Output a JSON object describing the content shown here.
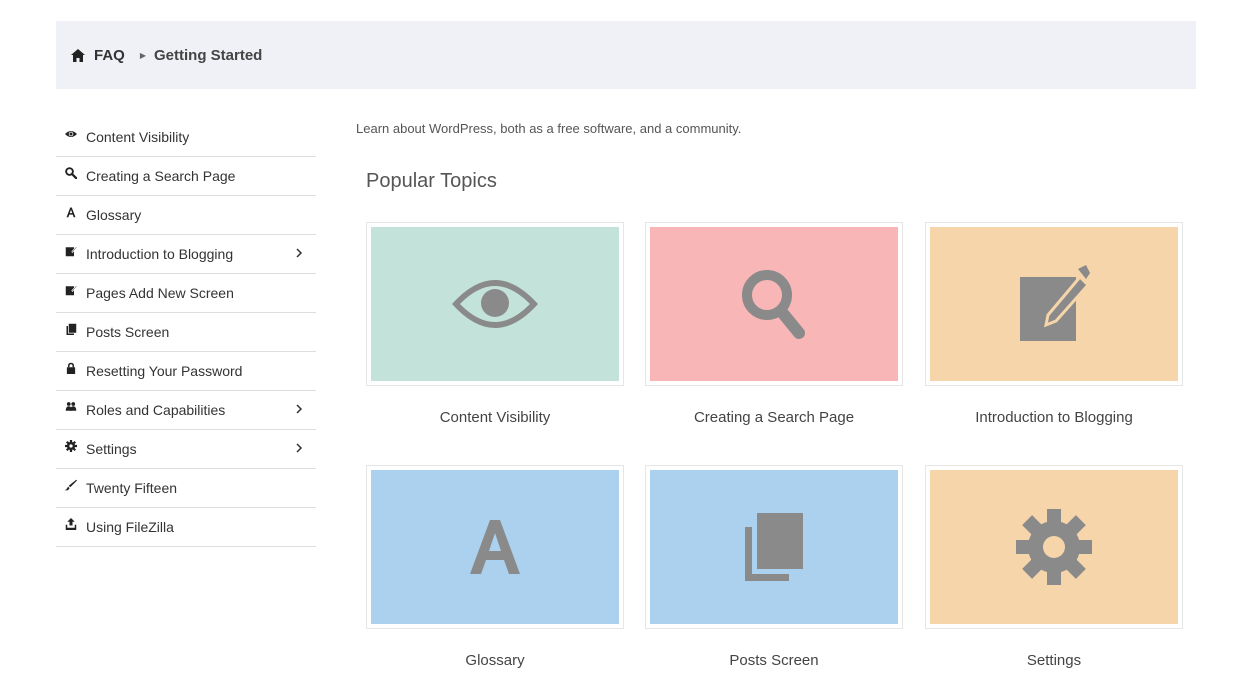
{
  "breadcrumb": {
    "home": "FAQ",
    "current": "Getting Started"
  },
  "sidebar": {
    "items": [
      {
        "label": "Content Visibility",
        "icon": "eye-icon",
        "submenu": false
      },
      {
        "label": "Creating a Search Page",
        "icon": "search-icon",
        "submenu": false
      },
      {
        "label": "Glossary",
        "icon": "font-icon",
        "submenu": false
      },
      {
        "label": "Introduction to Blogging",
        "icon": "edit-icon",
        "submenu": true
      },
      {
        "label": "Pages Add New Screen",
        "icon": "edit-icon",
        "submenu": false
      },
      {
        "label": "Posts Screen",
        "icon": "copy-icon",
        "submenu": false
      },
      {
        "label": "Resetting Your Password",
        "icon": "lock-icon",
        "submenu": false
      },
      {
        "label": "Roles and Capabilities",
        "icon": "users-icon",
        "submenu": true
      },
      {
        "label": "Settings",
        "icon": "gear-icon",
        "submenu": true
      },
      {
        "label": "Twenty Fifteen",
        "icon": "brush-icon",
        "submenu": false
      },
      {
        "label": "Using FileZilla",
        "icon": "upload-icon",
        "submenu": false
      }
    ]
  },
  "main": {
    "intro": "Learn about WordPress, both as a free software, and a community.",
    "section_title": "Popular Topics",
    "topics": [
      {
        "label": "Content Visibility",
        "icon": "eye-icon",
        "color": "#c3e2da"
      },
      {
        "label": "Creating a Search Page",
        "icon": "search-icon",
        "color": "#f8b6b6"
      },
      {
        "label": "Introduction to Blogging",
        "icon": "edit-icon",
        "color": "#f6d5aa"
      },
      {
        "label": "Glossary",
        "icon": "font-icon",
        "color": "#abd1ee"
      },
      {
        "label": "Posts Screen",
        "icon": "copy-icon",
        "color": "#abd1ee"
      },
      {
        "label": "Settings",
        "icon": "gear-icon",
        "color": "#f6d5aa"
      }
    ]
  },
  "colors": {
    "icon_gray": "#8a8a8a",
    "breadcrumb_bg": "#f0f1f6"
  }
}
